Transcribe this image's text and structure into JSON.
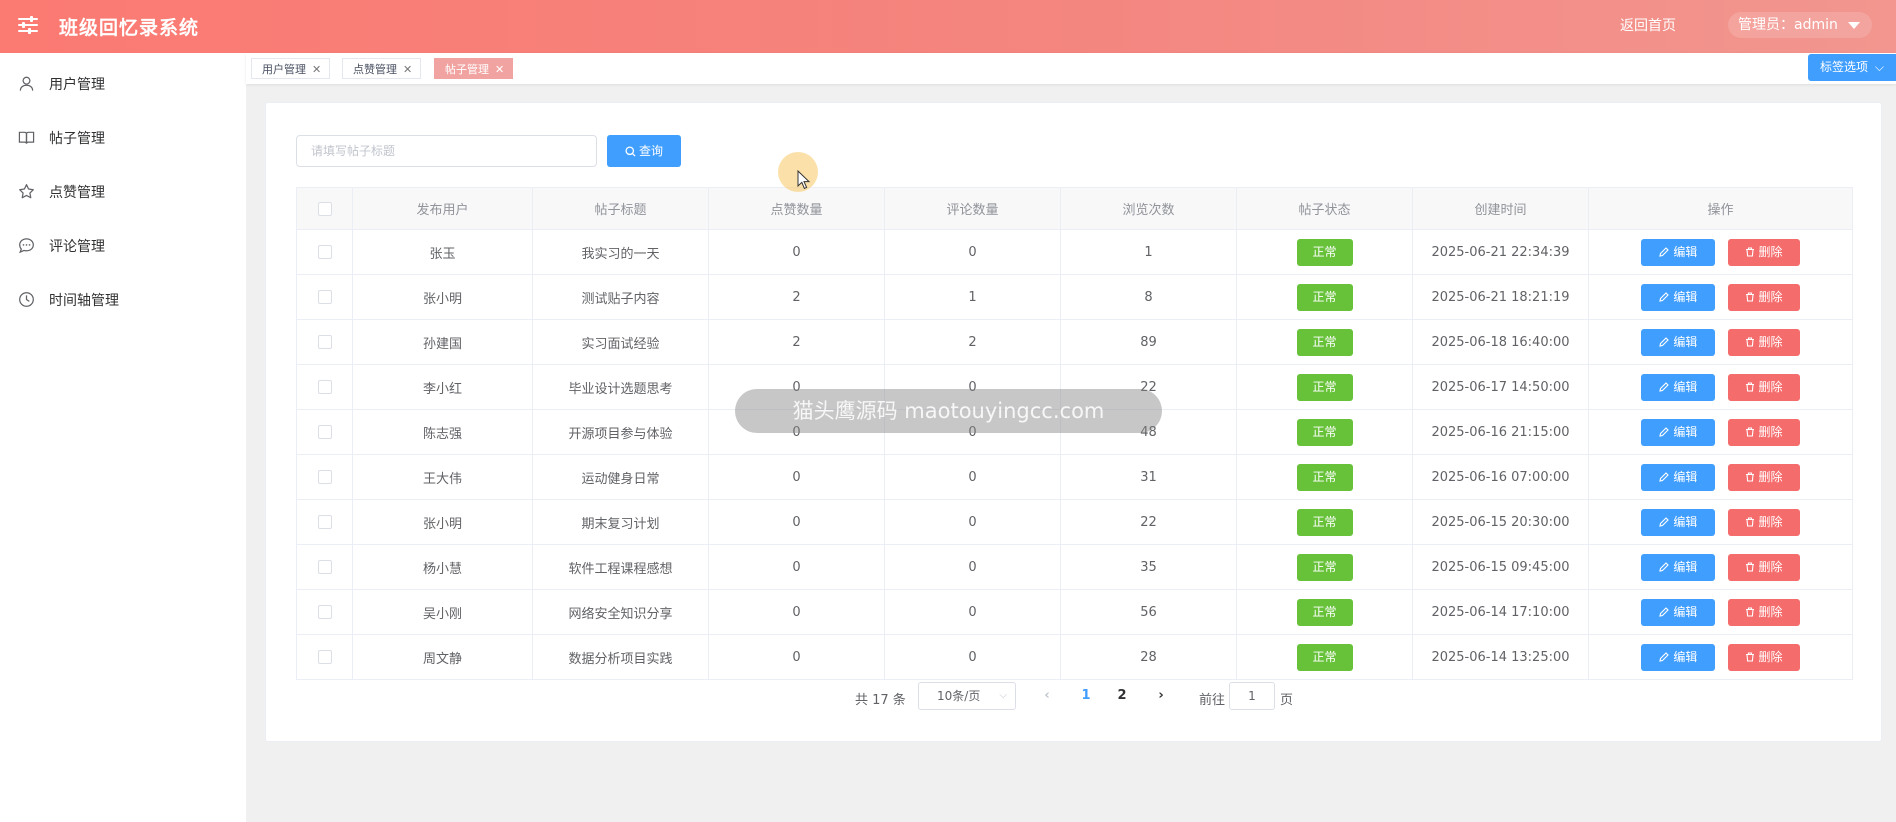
{
  "header": {
    "title": "班级回忆录系统",
    "home_link": "返回首页",
    "admin_label": "管理员：admin",
    "menu_icon": "sliders-icon"
  },
  "sidebar": {
    "items": [
      {
        "label": "用户管理",
        "icon": "user-icon"
      },
      {
        "label": "帖子管理",
        "icon": "book-icon"
      },
      {
        "label": "点赞管理",
        "icon": "star-icon"
      },
      {
        "label": "评论管理",
        "icon": "chat-icon"
      },
      {
        "label": "时间轴管理",
        "icon": "clock-icon"
      }
    ]
  },
  "tabs": [
    {
      "label": "用户管理",
      "active": false
    },
    {
      "label": "点赞管理",
      "active": false
    },
    {
      "label": "帖子管理",
      "active": true
    }
  ],
  "tab_options_label": "标签选项",
  "search": {
    "placeholder": "请填写帖子标题",
    "value": "",
    "button_label": "查询"
  },
  "table": {
    "columns": [
      "发布用户",
      "帖子标题",
      "点赞数量",
      "评论数量",
      "浏览次数",
      "帖子状态",
      "创建时间",
      "操作"
    ],
    "rows": [
      {
        "user": "张玉",
        "title": "我实习的一天",
        "likes": "0",
        "comments": "0",
        "views": "1",
        "status": "正常",
        "created": "2025-06-21 22:34:39"
      },
      {
        "user": "张小明",
        "title": "测试贴子内容",
        "likes": "2",
        "comments": "1",
        "views": "8",
        "status": "正常",
        "created": "2025-06-21 18:21:19"
      },
      {
        "user": "孙建国",
        "title": "实习面试经验",
        "likes": "2",
        "comments": "2",
        "views": "89",
        "status": "正常",
        "created": "2025-06-18 16:40:00"
      },
      {
        "user": "李小红",
        "title": "毕业设计选题思考",
        "likes": "0",
        "comments": "0",
        "views": "22",
        "status": "正常",
        "created": "2025-06-17 14:50:00"
      },
      {
        "user": "陈志强",
        "title": "开源项目参与体验",
        "likes": "0",
        "comments": "0",
        "views": "48",
        "status": "正常",
        "created": "2025-06-16 21:15:00"
      },
      {
        "user": "王大伟",
        "title": "运动健身日常",
        "likes": "0",
        "comments": "0",
        "views": "31",
        "status": "正常",
        "created": "2025-06-16 07:00:00"
      },
      {
        "user": "张小明",
        "title": "期末复习计划",
        "likes": "0",
        "comments": "0",
        "views": "22",
        "status": "正常",
        "created": "2025-06-15 20:30:00"
      },
      {
        "user": "杨小慧",
        "title": "软件工程课程感想",
        "likes": "0",
        "comments": "0",
        "views": "35",
        "status": "正常",
        "created": "2025-06-15 09:45:00"
      },
      {
        "user": "吴小刚",
        "title": "网络安全知识分享",
        "likes": "0",
        "comments": "0",
        "views": "56",
        "status": "正常",
        "created": "2025-06-14 17:10:00"
      },
      {
        "user": "周文静",
        "title": "数据分析项目实践",
        "likes": "0",
        "comments": "0",
        "views": "28",
        "status": "正常",
        "created": "2025-06-14 13:25:00"
      }
    ],
    "edit_label": "编辑",
    "delete_label": "删除"
  },
  "pagination": {
    "total_label": "共 17 条",
    "page_size_label": "10条/页",
    "pages": [
      "1",
      "2"
    ],
    "current_page": "1",
    "goto_label": "前往",
    "goto_value": "1",
    "page_suffix": "页"
  },
  "watermark": "猫头鹰源码 maotouyingcc.com",
  "colors": {
    "header_start": "#fb7a72",
    "header_end": "#f2968f",
    "primary": "#409eff",
    "success": "#67c23a",
    "danger": "#f56c6c",
    "active_tab": "#f1a3a1"
  }
}
